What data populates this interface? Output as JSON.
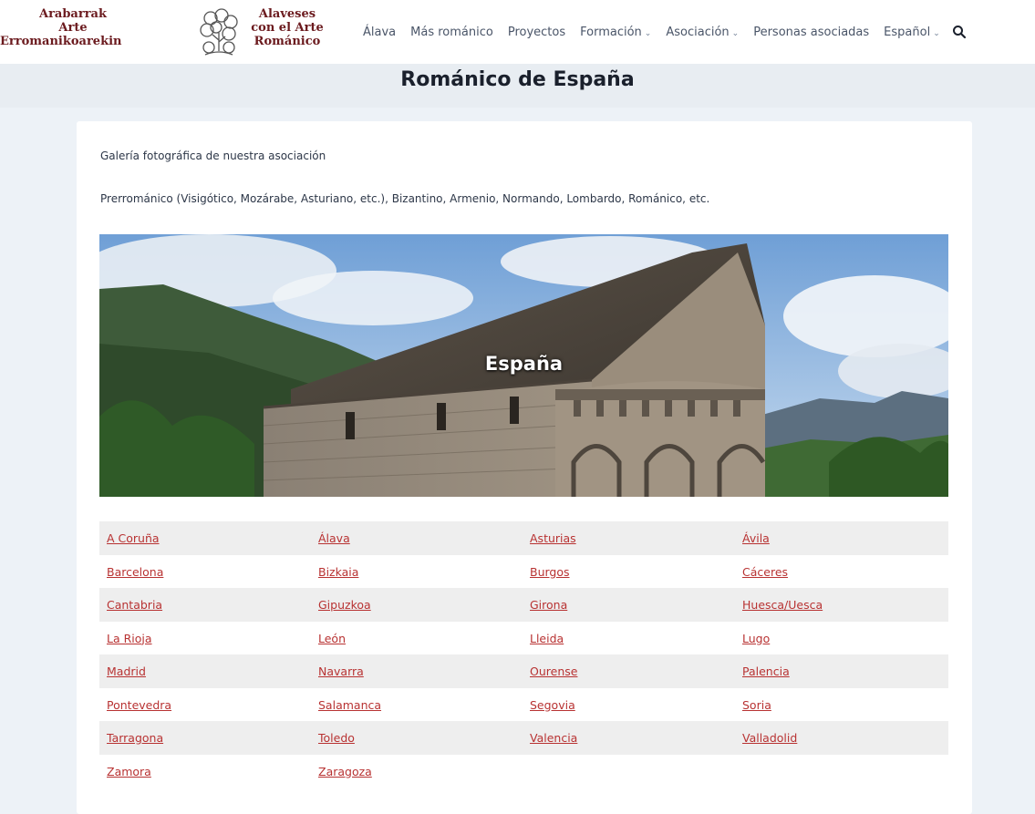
{
  "header": {
    "logo": {
      "left_lines": [
        "Arabarrak",
        "Arte",
        "Erromanikoarekin"
      ],
      "right_lines": [
        "Alaveses",
        "con el Arte",
        "Románico"
      ]
    },
    "nav": [
      {
        "label": "Álava",
        "dropdown": false
      },
      {
        "label": "Más románico",
        "dropdown": false
      },
      {
        "label": "Proyectos",
        "dropdown": false
      },
      {
        "label": "Formación",
        "dropdown": true
      },
      {
        "label": "Asociación",
        "dropdown": true
      },
      {
        "label": "Personas asociadas",
        "dropdown": false
      },
      {
        "label": "Español",
        "dropdown": true
      }
    ],
    "search_icon": "search-icon"
  },
  "page": {
    "title": "Románico de España",
    "intro_1": "Galería fotográfica de nuestra asociación",
    "intro_2": "Prerrománico (Visigótico, Mozárabe, Asturiano, etc.), Bizantino, Armenio, Normando, Lombardo, Románico, etc.",
    "hero_label": "España"
  },
  "regions": [
    [
      "A Coruña",
      "Álava",
      "Asturias",
      "Ávila"
    ],
    [
      "Barcelona",
      "Bizkaia",
      "Burgos",
      "Cáceres"
    ],
    [
      "Cantabria",
      "Gipuzkoa",
      "Girona",
      "Huesca/Uesca"
    ],
    [
      "La Rioja",
      "León",
      "Lleida",
      "Lugo"
    ],
    [
      "Madrid",
      "Navarra",
      "Ourense",
      "Palencia"
    ],
    [
      "Pontevedra",
      "Salamanca",
      "Segovia",
      "Soria"
    ],
    [
      "Tarragona",
      "Toledo",
      "Valencia",
      "Valladolid"
    ],
    [
      "Zamora",
      "Zaragoza",
      "",
      ""
    ]
  ],
  "colors": {
    "link": "#b83232",
    "logo": "#6b1a1e",
    "background": "#edf2f7"
  }
}
